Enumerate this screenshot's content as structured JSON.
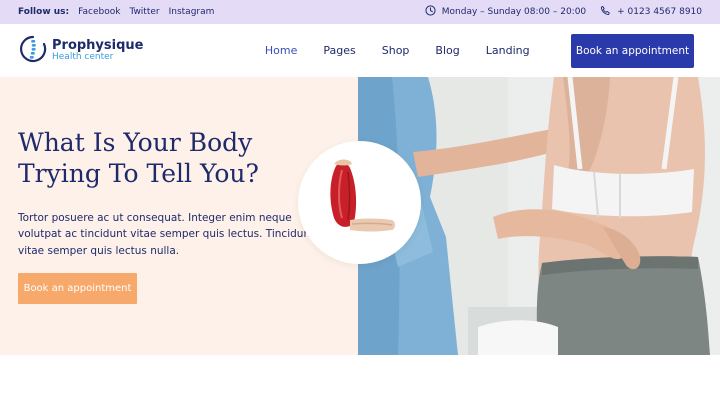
{
  "topbar": {
    "follow_label": "Follow us:",
    "social_links": [
      "Facebook",
      "Twitter",
      "Instagram"
    ],
    "hours": "Monday – Sunday 08:00 – 20:00",
    "phone": "+ 0123 4567 8910",
    "icons": {
      "hours": "clock-icon",
      "phone": "phone-icon"
    }
  },
  "header": {
    "brand_name": "Prophysique",
    "brand_tagline": "Health center",
    "nav": [
      "Home",
      "Pages",
      "Shop",
      "Blog",
      "Landing"
    ],
    "active_nav": "Home",
    "cta": "Book an appointment"
  },
  "hero": {
    "headline_line1": "What Is Your Body",
    "headline_line2": "Trying To Tell You?",
    "description": "Tortor posuere ac ut consequat. Integer enim neque volutpat ac tincidunt vitae semper quis lectus. Tincidunt vitae semper quis lectus nulla.",
    "cta": "Book an appointment",
    "badge_icon": "arm-muscle-icon"
  },
  "colors": {
    "topbar_bg": "#e4dcf7",
    "primary": "#2b3aab",
    "navy_text": "#1f2a6b",
    "accent_orange": "#f7a86b",
    "hero_bg": "#fdf1ea",
    "brand_blue": "#3a9de0"
  }
}
